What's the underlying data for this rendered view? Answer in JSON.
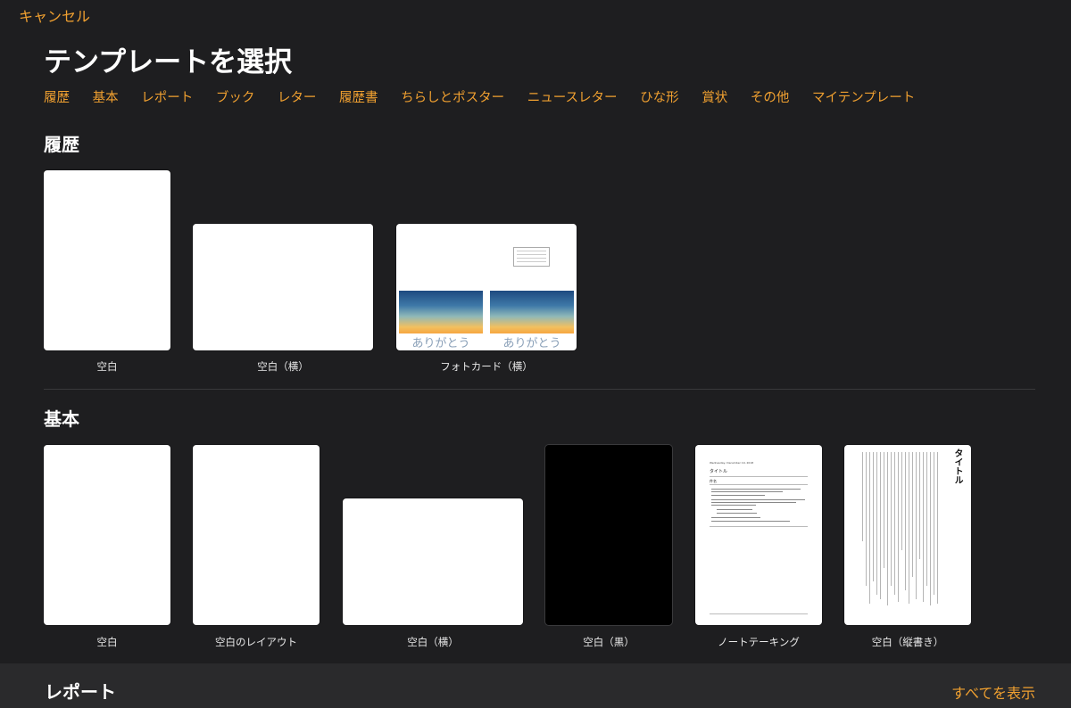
{
  "header": {
    "cancel_label": "キャンセル",
    "title": "テンプレートを選択"
  },
  "categories": [
    "履歴",
    "基本",
    "レポート",
    "ブック",
    "レター",
    "履歴書",
    "ちらしとポスター",
    "ニュースレター",
    "ひな形",
    "賞状",
    "その他",
    "マイテンプレート"
  ],
  "sections": {
    "recent": {
      "title": "履歴",
      "items": [
        {
          "caption": "空白"
        },
        {
          "caption": "空白（横）"
        },
        {
          "caption": "フォトカード（横）",
          "card_text_1": "ありがとう",
          "card_text_2": "ありがとう"
        }
      ]
    },
    "basic": {
      "title": "基本",
      "items": [
        {
          "caption": "空白"
        },
        {
          "caption": "空白のレイアウト"
        },
        {
          "caption": "空白（横）"
        },
        {
          "caption": "空白（黒）"
        },
        {
          "caption": "ノートテーキング",
          "doc_date": "Wednesday, December 19, 2018",
          "doc_title": "タイトル",
          "doc_heading": "件名"
        },
        {
          "caption": "空白（縦書き）",
          "doc_title": "タイトル"
        }
      ]
    },
    "report": {
      "title": "レポート",
      "show_all_label": "すべてを表示"
    }
  },
  "colors": {
    "accent": "#f0a030",
    "background": "#1e1e20"
  }
}
